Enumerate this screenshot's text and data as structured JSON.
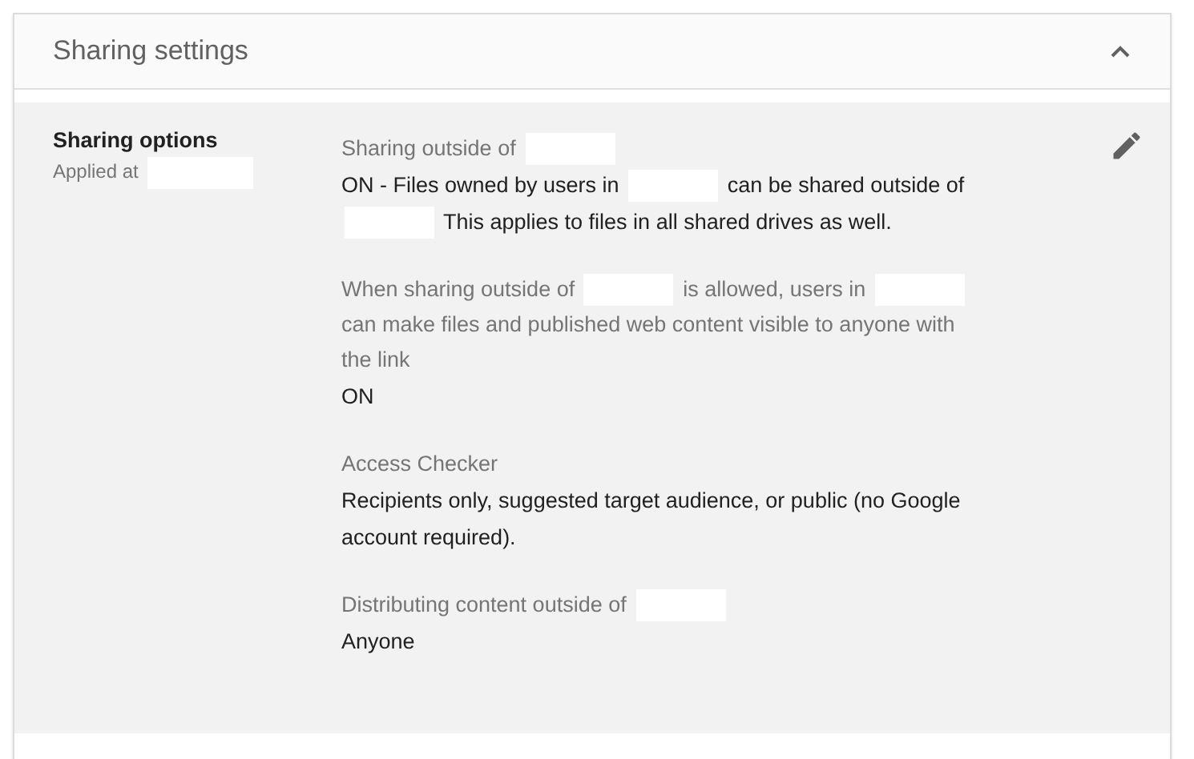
{
  "panel": {
    "title": "Sharing settings",
    "expanded": true
  },
  "setting": {
    "name": "Sharing options",
    "applied": [
      {
        "kind": "text",
        "text": "Applied at"
      },
      {
        "kind": "redacted"
      }
    ],
    "sections": [
      {
        "label": [
          {
            "kind": "text",
            "text": "Sharing outside of"
          },
          {
            "kind": "redacted"
          }
        ],
        "value": [
          {
            "kind": "text",
            "text": "ON - Files owned by users in"
          },
          {
            "kind": "redacted"
          },
          {
            "kind": "text",
            "text": "can be shared outside of"
          },
          {
            "kind": "redacted"
          },
          {
            "kind": "text",
            "text": "This applies to files in all shared drives as well."
          }
        ]
      },
      {
        "label": [
          {
            "kind": "text",
            "text": "When sharing outside of"
          },
          {
            "kind": "redacted"
          },
          {
            "kind": "text",
            "text": "is allowed, users in"
          },
          {
            "kind": "redacted"
          },
          {
            "kind": "text",
            "text": "can make files and published web content visible to anyone with the link"
          }
        ],
        "value": [
          {
            "kind": "text",
            "text": "ON"
          }
        ]
      },
      {
        "label": [
          {
            "kind": "text",
            "text": "Access Checker"
          }
        ],
        "value": [
          {
            "kind": "text",
            "text": "Recipients only, suggested target audience, or public (no Google account required)."
          }
        ]
      },
      {
        "label": [
          {
            "kind": "text",
            "text": "Distributing content outside of"
          },
          {
            "kind": "redacted"
          }
        ],
        "value": [
          {
            "kind": "text",
            "text": "Anyone"
          }
        ]
      }
    ]
  }
}
